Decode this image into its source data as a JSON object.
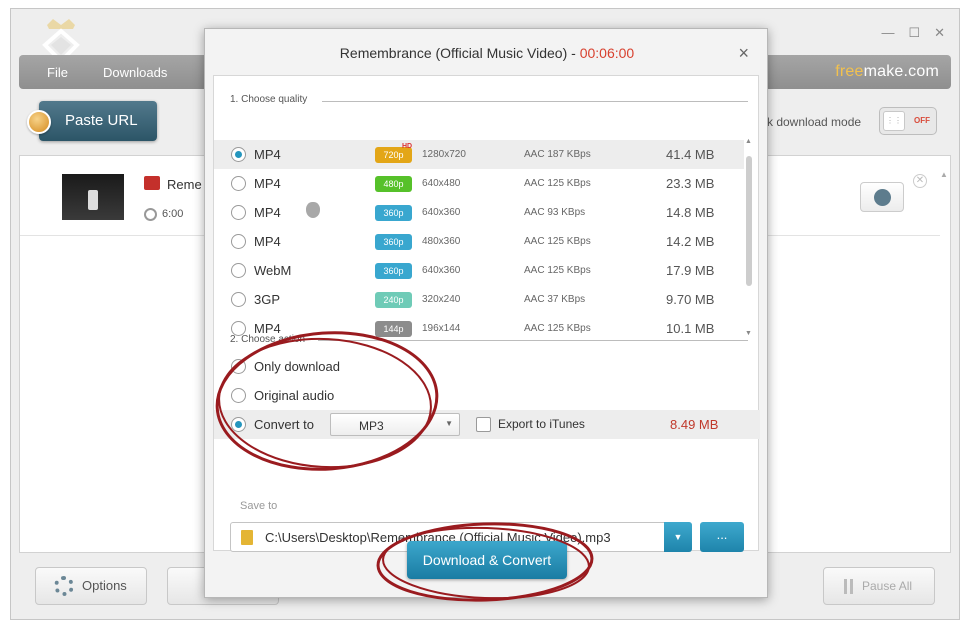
{
  "window": {
    "controls": {
      "minimize": "—",
      "maximize": "☐",
      "close": "✕"
    }
  },
  "menu": {
    "file": "File",
    "downloads": "Downloads"
  },
  "brand": {
    "part1": "free",
    "part2": "make.com"
  },
  "toolbar": {
    "paste_url": "Paste URL",
    "mode_label": "k download mode",
    "toggle_state": "OFF"
  },
  "download_item": {
    "title": "Reme",
    "duration": "6:00"
  },
  "bottom": {
    "options": "Options",
    "pause_all": "Pause All"
  },
  "dialog": {
    "title": "Remembrance (Official Music Video) - ",
    "title_duration": "00:06:00",
    "close": "×",
    "quality_section": "1. Choose quality",
    "action_section": "2. Choose action",
    "qualities": [
      {
        "format": "MP4",
        "badge": "720p",
        "hd": "HD",
        "badge_color": "#e3a617",
        "resolution": "1280x720",
        "audio": "AAC 187  KBps",
        "size": "41.4 MB",
        "selected": true
      },
      {
        "format": "MP4",
        "badge": "480p",
        "badge_color": "#56c12a",
        "resolution": "640x480",
        "audio": "AAC 125  KBps",
        "size": "23.3 MB"
      },
      {
        "format": "MP4",
        "badge": "360p",
        "badge_color": "#39a7cf",
        "resolution": "640x360",
        "audio": "AAC 93  KBps",
        "size": "14.8 MB",
        "apple": true
      },
      {
        "format": "MP4",
        "badge": "360p",
        "badge_color": "#39a7cf",
        "resolution": "480x360",
        "audio": "AAC 125  KBps",
        "size": "14.2 MB"
      },
      {
        "format": "WebM",
        "badge": "360p",
        "badge_color": "#39a7cf",
        "resolution": "640x360",
        "audio": "AAC 125  KBps",
        "size": "17.9 MB"
      },
      {
        "format": "3GP",
        "badge": "240p",
        "badge_color": "#6fcbb7",
        "resolution": "320x240",
        "audio": "AAC 37  KBps",
        "size": "9.70 MB"
      },
      {
        "format": "MP4",
        "badge": "144p",
        "badge_color": "#8c8c8c",
        "resolution": "196x144",
        "audio": "AAC 125  KBps",
        "size": "10.1 MB"
      }
    ],
    "actions": {
      "only_download": "Only download",
      "original_audio": "Original audio",
      "convert_to": "Convert to",
      "convert_format": "MP3",
      "export_itunes": "Export to iTunes",
      "convert_size": "8.49 MB"
    },
    "save_to_label": "Save to",
    "save_path": "C:\\Users\\Desktop\\Remembrance (Official Music Video).mp3",
    "browse": "...",
    "download_convert": "Download & Convert"
  },
  "colors": {
    "accent": "#2596be",
    "annotation": "#9a1b1f",
    "duration": "#d8412f"
  }
}
